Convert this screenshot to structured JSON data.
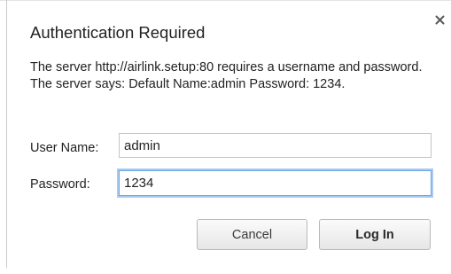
{
  "dialog": {
    "title": "Authentication Required",
    "message": "The server http://airlink.setup:80 requires a username and password. The server says: Default Name:admin Password: 1234.",
    "close_icon": "close-x-icon"
  },
  "form": {
    "username_label": "User Name:",
    "username_value": "admin",
    "password_label": "Password:",
    "password_value": "1234"
  },
  "buttons": {
    "cancel_label": "Cancel",
    "login_label": "Log In"
  },
  "colors": {
    "focus_ring": "#6fa6e2",
    "text": "#222222"
  }
}
